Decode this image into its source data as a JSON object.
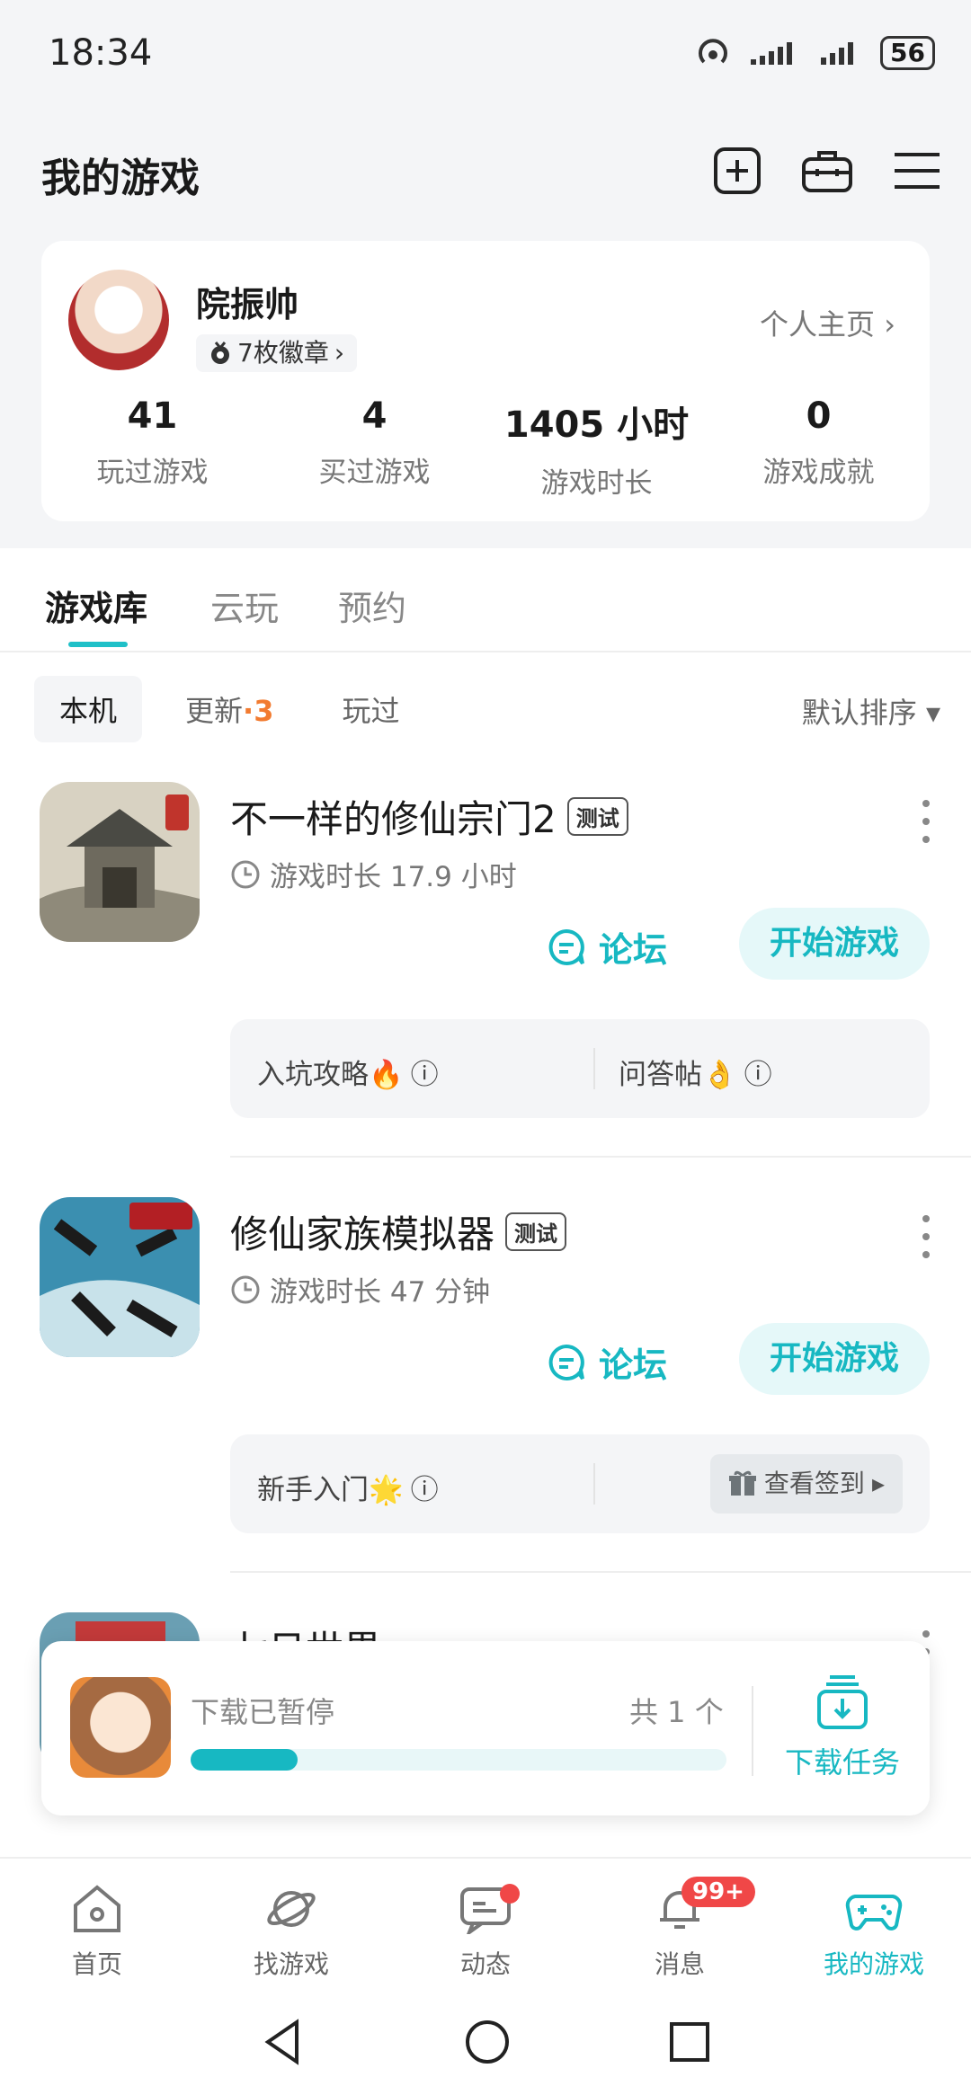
{
  "status": {
    "time": "18:34",
    "battery": "56"
  },
  "header": {
    "title": "我的游戏"
  },
  "profile": {
    "name": "院振帅",
    "badges": "7枚徽章",
    "homepage_link": "个人主页",
    "stats": [
      {
        "value": "41",
        "label": "玩过游戏"
      },
      {
        "value": "4",
        "label": "买过游戏"
      },
      {
        "value": "1405 小时",
        "label": "游戏时长"
      },
      {
        "value": "0",
        "label": "游戏成就"
      }
    ]
  },
  "tabs": {
    "library": "游戏库",
    "cloud": "云玩",
    "reserve": "预约"
  },
  "subtabs": {
    "local": "本机",
    "update": "更新",
    "update_sep": "·",
    "update_count": "3",
    "played": "玩过"
  },
  "sort": "默认排序",
  "games": [
    {
      "title": "不一样的修仙宗门2",
      "tag": "测试",
      "playtime": "游戏时长 17.9 小时",
      "forum": "论坛",
      "play": "开始游戏",
      "link1": "入坑攻略🔥",
      "link2": "问答帖👌"
    },
    {
      "title": "修仙家族模拟器",
      "tag": "测试",
      "playtime": "游戏时长 47 分钟",
      "forum": "论坛",
      "play": "开始游戏",
      "link1": "新手入门🌟",
      "sign": "查看签到"
    },
    {
      "title": "七日世界"
    }
  ],
  "download": {
    "status": "下载已暂停",
    "count": "共 1 个",
    "progress": 0.2,
    "task": "下载任务"
  },
  "nav": {
    "home": "首页",
    "discover": "找游戏",
    "feed": "动态",
    "messages": "消息",
    "messages_badge": "99+",
    "mygames": "我的游戏"
  },
  "colors": {
    "accent": "#17b8c2",
    "badge_red": "#f04747",
    "update_orange": "#f27b30"
  }
}
